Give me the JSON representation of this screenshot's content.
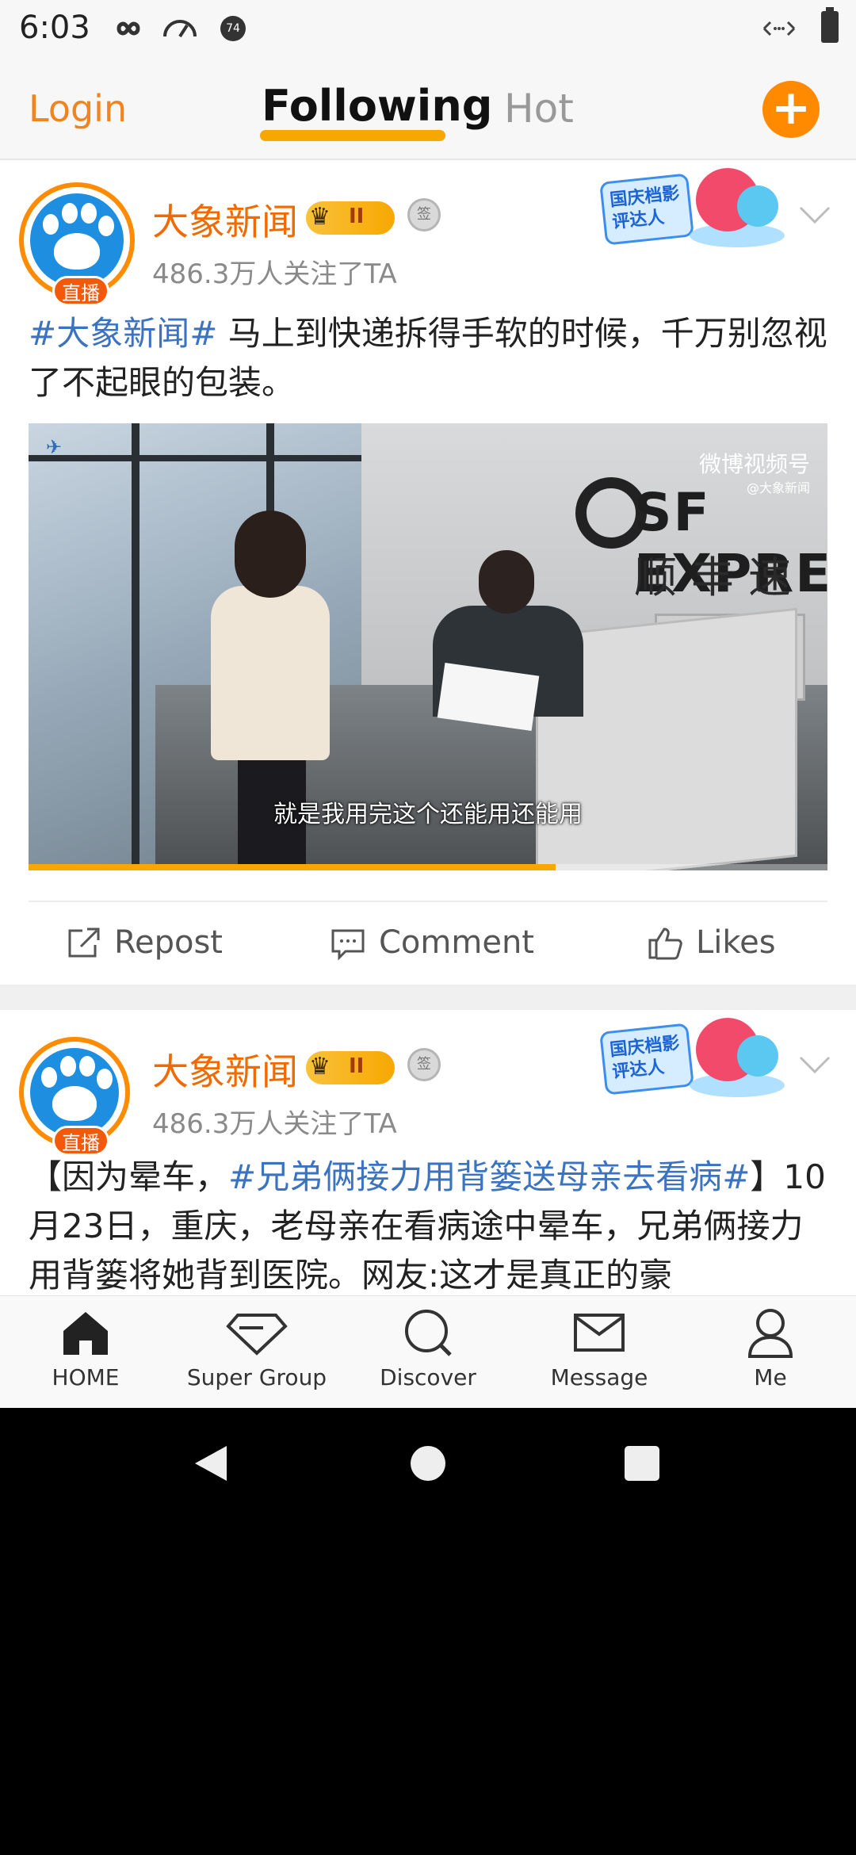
{
  "status_bar": {
    "time": "6:03",
    "icons": [
      "infinity-icon",
      "speedometer-icon",
      "notification-count-icon",
      "data-arrows-icon",
      "battery-icon"
    ],
    "badge": "74"
  },
  "top_nav": {
    "login": "Login",
    "tab_following": "Following",
    "tab_hot": "Hot",
    "plus": "+"
  },
  "post1": {
    "username": "大象新闻",
    "vip_level": "II",
    "live_badge": "直播",
    "followers": "486.3万人关注了TA",
    "promo_text": "国庆档影评达人",
    "hashtag": "#大象新闻#",
    "text": " 马上到快递拆得手软的时候，千万别忽视了不起眼的包装。",
    "video": {
      "subtitle": "就是我用完这个还能用还能用",
      "watermark": "微博视频号",
      "watermark_sub": "@大象新闻",
      "sign_en": "SF EXPRE",
      "sign_cn": "顺丰速",
      "progress": 0.66
    },
    "actions": {
      "repost": "Repost",
      "comment": "Comment",
      "likes": "Likes"
    }
  },
  "post2": {
    "username": "大象新闻",
    "vip_level": "II",
    "live_badge": "直播",
    "followers": "486.3万人关注了TA",
    "promo_text": "国庆档影评达人",
    "text_prefix": "【因为晕车，",
    "hashtag": "#兄弟俩接力用背篓送母亲去看病#",
    "text_rest": "】10月23日，重庆，老母亲在看病途中晕车，兄弟俩接力用背篓将她背到医院。网友:这才是真正的豪"
  },
  "bottom_nav": {
    "home": "HOME",
    "super_group": "Super Group",
    "discover": "Discover",
    "message": "Message",
    "me": "Me"
  },
  "colors": {
    "accent": "#f08420",
    "orange_button": "#ff8a00",
    "tab_underline": "#f7a800",
    "hashtag": "#3c73c0",
    "username": "#f06a00"
  }
}
